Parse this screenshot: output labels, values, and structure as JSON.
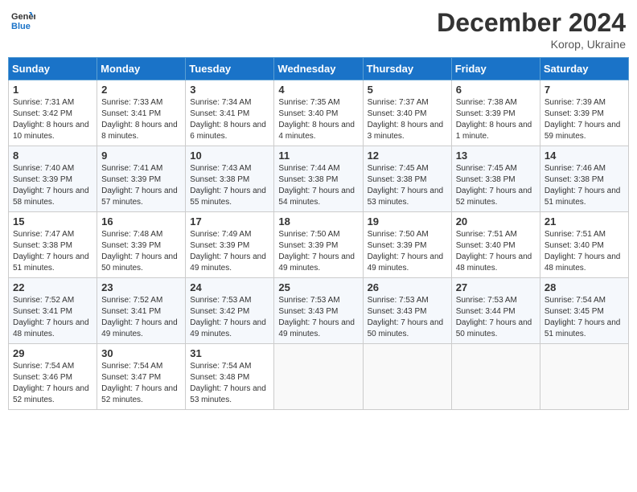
{
  "header": {
    "logo_line1": "General",
    "logo_line2": "Blue",
    "month_title": "December 2024",
    "location": "Korop, Ukraine"
  },
  "days_of_week": [
    "Sunday",
    "Monday",
    "Tuesday",
    "Wednesday",
    "Thursday",
    "Friday",
    "Saturday"
  ],
  "weeks": [
    [
      {
        "day": "1",
        "sunrise": "Sunrise: 7:31 AM",
        "sunset": "Sunset: 3:42 PM",
        "daylight": "Daylight: 8 hours and 10 minutes."
      },
      {
        "day": "2",
        "sunrise": "Sunrise: 7:33 AM",
        "sunset": "Sunset: 3:41 PM",
        "daylight": "Daylight: 8 hours and 8 minutes."
      },
      {
        "day": "3",
        "sunrise": "Sunrise: 7:34 AM",
        "sunset": "Sunset: 3:41 PM",
        "daylight": "Daylight: 8 hours and 6 minutes."
      },
      {
        "day": "4",
        "sunrise": "Sunrise: 7:35 AM",
        "sunset": "Sunset: 3:40 PM",
        "daylight": "Daylight: 8 hours and 4 minutes."
      },
      {
        "day": "5",
        "sunrise": "Sunrise: 7:37 AM",
        "sunset": "Sunset: 3:40 PM",
        "daylight": "Daylight: 8 hours and 3 minutes."
      },
      {
        "day": "6",
        "sunrise": "Sunrise: 7:38 AM",
        "sunset": "Sunset: 3:39 PM",
        "daylight": "Daylight: 8 hours and 1 minute."
      },
      {
        "day": "7",
        "sunrise": "Sunrise: 7:39 AM",
        "sunset": "Sunset: 3:39 PM",
        "daylight": "Daylight: 7 hours and 59 minutes."
      }
    ],
    [
      {
        "day": "8",
        "sunrise": "Sunrise: 7:40 AM",
        "sunset": "Sunset: 3:39 PM",
        "daylight": "Daylight: 7 hours and 58 minutes."
      },
      {
        "day": "9",
        "sunrise": "Sunrise: 7:41 AM",
        "sunset": "Sunset: 3:39 PM",
        "daylight": "Daylight: 7 hours and 57 minutes."
      },
      {
        "day": "10",
        "sunrise": "Sunrise: 7:43 AM",
        "sunset": "Sunset: 3:38 PM",
        "daylight": "Daylight: 7 hours and 55 minutes."
      },
      {
        "day": "11",
        "sunrise": "Sunrise: 7:44 AM",
        "sunset": "Sunset: 3:38 PM",
        "daylight": "Daylight: 7 hours and 54 minutes."
      },
      {
        "day": "12",
        "sunrise": "Sunrise: 7:45 AM",
        "sunset": "Sunset: 3:38 PM",
        "daylight": "Daylight: 7 hours and 53 minutes."
      },
      {
        "day": "13",
        "sunrise": "Sunrise: 7:45 AM",
        "sunset": "Sunset: 3:38 PM",
        "daylight": "Daylight: 7 hours and 52 minutes."
      },
      {
        "day": "14",
        "sunrise": "Sunrise: 7:46 AM",
        "sunset": "Sunset: 3:38 PM",
        "daylight": "Daylight: 7 hours and 51 minutes."
      }
    ],
    [
      {
        "day": "15",
        "sunrise": "Sunrise: 7:47 AM",
        "sunset": "Sunset: 3:38 PM",
        "daylight": "Daylight: 7 hours and 51 minutes."
      },
      {
        "day": "16",
        "sunrise": "Sunrise: 7:48 AM",
        "sunset": "Sunset: 3:39 PM",
        "daylight": "Daylight: 7 hours and 50 minutes."
      },
      {
        "day": "17",
        "sunrise": "Sunrise: 7:49 AM",
        "sunset": "Sunset: 3:39 PM",
        "daylight": "Daylight: 7 hours and 49 minutes."
      },
      {
        "day": "18",
        "sunrise": "Sunrise: 7:50 AM",
        "sunset": "Sunset: 3:39 PM",
        "daylight": "Daylight: 7 hours and 49 minutes."
      },
      {
        "day": "19",
        "sunrise": "Sunrise: 7:50 AM",
        "sunset": "Sunset: 3:39 PM",
        "daylight": "Daylight: 7 hours and 49 minutes."
      },
      {
        "day": "20",
        "sunrise": "Sunrise: 7:51 AM",
        "sunset": "Sunset: 3:40 PM",
        "daylight": "Daylight: 7 hours and 48 minutes."
      },
      {
        "day": "21",
        "sunrise": "Sunrise: 7:51 AM",
        "sunset": "Sunset: 3:40 PM",
        "daylight": "Daylight: 7 hours and 48 minutes."
      }
    ],
    [
      {
        "day": "22",
        "sunrise": "Sunrise: 7:52 AM",
        "sunset": "Sunset: 3:41 PM",
        "daylight": "Daylight: 7 hours and 48 minutes."
      },
      {
        "day": "23",
        "sunrise": "Sunrise: 7:52 AM",
        "sunset": "Sunset: 3:41 PM",
        "daylight": "Daylight: 7 hours and 49 minutes."
      },
      {
        "day": "24",
        "sunrise": "Sunrise: 7:53 AM",
        "sunset": "Sunset: 3:42 PM",
        "daylight": "Daylight: 7 hours and 49 minutes."
      },
      {
        "day": "25",
        "sunrise": "Sunrise: 7:53 AM",
        "sunset": "Sunset: 3:43 PM",
        "daylight": "Daylight: 7 hours and 49 minutes."
      },
      {
        "day": "26",
        "sunrise": "Sunrise: 7:53 AM",
        "sunset": "Sunset: 3:43 PM",
        "daylight": "Daylight: 7 hours and 50 minutes."
      },
      {
        "day": "27",
        "sunrise": "Sunrise: 7:53 AM",
        "sunset": "Sunset: 3:44 PM",
        "daylight": "Daylight: 7 hours and 50 minutes."
      },
      {
        "day": "28",
        "sunrise": "Sunrise: 7:54 AM",
        "sunset": "Sunset: 3:45 PM",
        "daylight": "Daylight: 7 hours and 51 minutes."
      }
    ],
    [
      {
        "day": "29",
        "sunrise": "Sunrise: 7:54 AM",
        "sunset": "Sunset: 3:46 PM",
        "daylight": "Daylight: 7 hours and 52 minutes."
      },
      {
        "day": "30",
        "sunrise": "Sunrise: 7:54 AM",
        "sunset": "Sunset: 3:47 PM",
        "daylight": "Daylight: 7 hours and 52 minutes."
      },
      {
        "day": "31",
        "sunrise": "Sunrise: 7:54 AM",
        "sunset": "Sunset: 3:48 PM",
        "daylight": "Daylight: 7 hours and 53 minutes."
      },
      null,
      null,
      null,
      null
    ]
  ]
}
